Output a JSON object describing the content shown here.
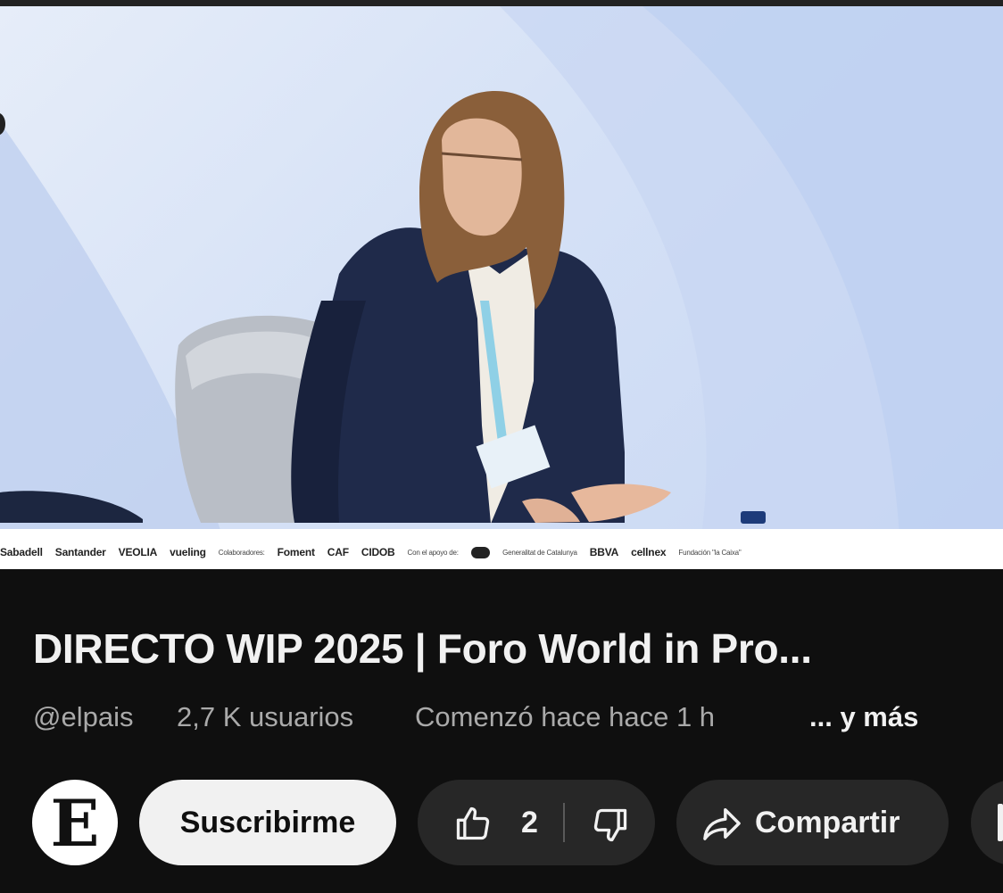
{
  "video": {
    "sponsors": [
      "Sabadell",
      "Santander",
      "VEOLIA",
      "vueling",
      "Colaboradores:",
      "Foment",
      "CAF",
      "CIDOB",
      "Con el apoyo de:",
      "Generalitat de Catalunya",
      "BBVA",
      "cellnex",
      "Fundación \"la Caixa\""
    ]
  },
  "title": "DIRECTO WIP 2025 | Foro World in Pro...",
  "meta": {
    "channel": "@elpais",
    "viewers": "2,7 K usuarios",
    "started": "Comenzó hace hace 1 h",
    "more": "... y más"
  },
  "channel": {
    "avatar_letter": "E"
  },
  "actions": {
    "subscribe_label": "Suscribirme",
    "like_count": "2",
    "share_label": "Compartir"
  },
  "icons": {
    "like": "thumbs-up-icon",
    "dislike": "thumbs-down-icon",
    "share": "share-arrow-icon"
  }
}
